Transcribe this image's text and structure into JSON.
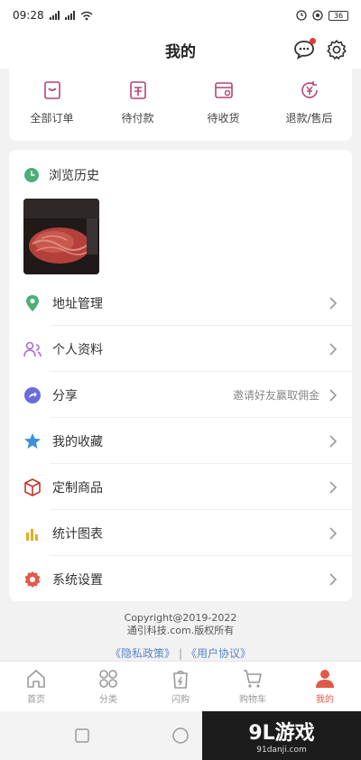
{
  "status": {
    "time": "09:28",
    "battery": "36"
  },
  "header": {
    "title": "我的"
  },
  "orders": [
    {
      "label": "全部订单",
      "icon": "order-list-icon"
    },
    {
      "label": "待付款",
      "icon": "wallet-icon"
    },
    {
      "label": "待收货",
      "icon": "package-icon"
    },
    {
      "label": "退款/售后",
      "icon": "refund-icon"
    }
  ],
  "history": {
    "title": "浏览历史"
  },
  "menu": [
    {
      "label": "地址管理",
      "hint": "",
      "icon": "location-icon",
      "color": "#4caf7a"
    },
    {
      "label": "个人资料",
      "hint": "",
      "icon": "profile-icon",
      "color": "#b06ad0"
    },
    {
      "label": "分享",
      "hint": "邀请好友赢取佣金",
      "icon": "share-icon",
      "color": "#6b6be0"
    },
    {
      "label": "我的收藏",
      "hint": "",
      "icon": "star-icon",
      "color": "#3d8fd6"
    },
    {
      "label": "定制商品",
      "hint": "",
      "icon": "box-icon",
      "color": "#c0392b"
    },
    {
      "label": "统计图表",
      "hint": "",
      "icon": "bar-chart-icon",
      "color": "#e0b020"
    },
    {
      "label": "系统设置",
      "hint": "",
      "icon": "settings-icon",
      "color": "#e05a4a"
    }
  ],
  "footer": {
    "copyright_line1": "Copyright@2019-2022",
    "copyright_line2": "通引科技.com.版权所有",
    "privacy": "《隐私政策》",
    "separator": "|",
    "agreement": "《用户协议》"
  },
  "tabs": [
    {
      "label": "首页",
      "icon": "home-icon",
      "active": false
    },
    {
      "label": "分类",
      "icon": "category-icon",
      "active": false
    },
    {
      "label": "闪购",
      "icon": "flash-sale-icon",
      "active": false
    },
    {
      "label": "购物车",
      "icon": "cart-icon",
      "active": false
    },
    {
      "label": "我的",
      "icon": "user-icon",
      "active": true
    }
  ],
  "watermark": {
    "brand": "9L游戏",
    "site": "91danji.com"
  },
  "colors": {
    "accent": "#e05a4a",
    "order_icon": "#b0457a",
    "link": "#5a86c8"
  }
}
